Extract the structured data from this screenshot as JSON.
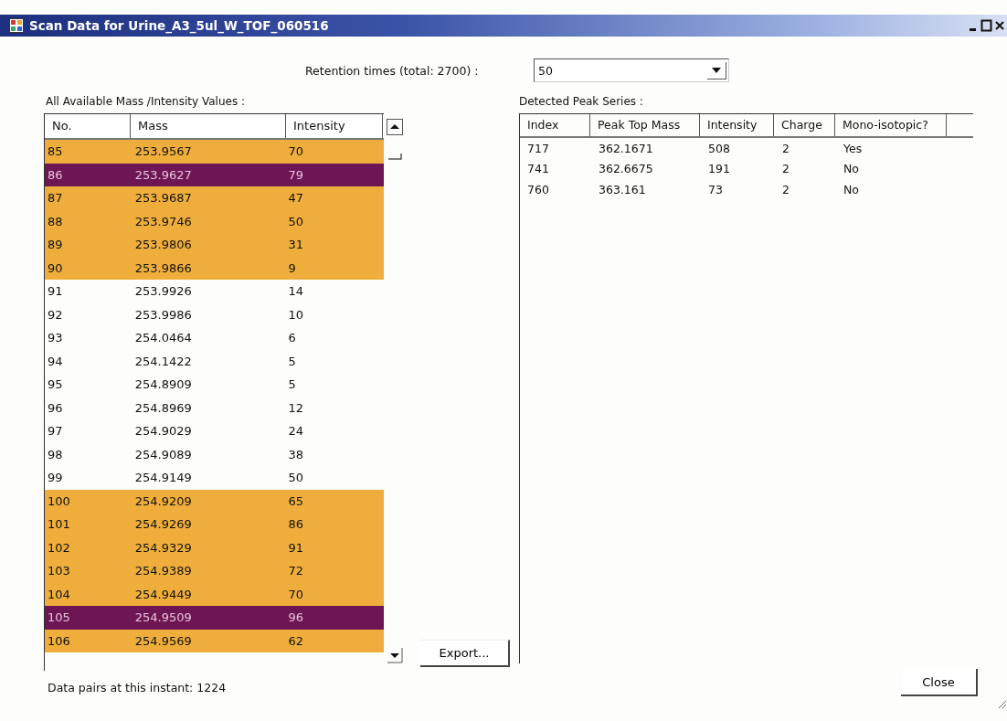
{
  "window": {
    "title": "Scan Data for Urine_A3_5ul_W_TOF_060516"
  },
  "retention": {
    "label": "Retention times (total: 2700) :",
    "value": "50"
  },
  "mass_table": {
    "title": "All Available Mass /Intensity Values :",
    "columns": [
      "No.",
      "Mass",
      "Intensity"
    ],
    "rows": [
      {
        "cells": [
          "85",
          "253.9567",
          "70"
        ],
        "color": "#efae3c"
      },
      {
        "cells": [
          "86",
          "253.9627",
          "79"
        ],
        "color": "#6e1654"
      },
      {
        "cells": [
          "87",
          "253.9687",
          "47"
        ],
        "color": "#efae3c"
      },
      {
        "cells": [
          "88",
          "253.9746",
          "50"
        ],
        "color": "#efae3c"
      },
      {
        "cells": [
          "89",
          "253.9806",
          "31"
        ],
        "color": "#efae3c"
      },
      {
        "cells": [
          "90",
          "253.9866",
          "9"
        ],
        "color": "#efae3c"
      },
      {
        "cells": [
          "91",
          "253.9926",
          "14"
        ]
      },
      {
        "cells": [
          "92",
          "253.9986",
          "10"
        ]
      },
      {
        "cells": [
          "93",
          "254.0464",
          "6"
        ]
      },
      {
        "cells": [
          "94",
          "254.1422",
          "5"
        ]
      },
      {
        "cells": [
          "95",
          "254.8909",
          "5"
        ]
      },
      {
        "cells": [
          "96",
          "254.8969",
          "12"
        ]
      },
      {
        "cells": [
          "97",
          "254.9029",
          "24"
        ]
      },
      {
        "cells": [
          "98",
          "254.9089",
          "38"
        ]
      },
      {
        "cells": [
          "99",
          "254.9149",
          "50"
        ]
      },
      {
        "cells": [
          "100",
          "254.9209",
          "65"
        ],
        "color": "#efae3c"
      },
      {
        "cells": [
          "101",
          "254.9269",
          "86"
        ],
        "color": "#efae3c"
      },
      {
        "cells": [
          "102",
          "254.9329",
          "91"
        ],
        "color": "#efae3c"
      },
      {
        "cells": [
          "103",
          "254.9389",
          "72"
        ],
        "color": "#efae3c"
      },
      {
        "cells": [
          "104",
          "254.9449",
          "70"
        ],
        "color": "#efae3c"
      },
      {
        "cells": [
          "105",
          "254.9509",
          "96"
        ],
        "color": "#6e1654"
      },
      {
        "cells": [
          "106",
          "254.9569",
          "62"
        ],
        "color": "#efae3c"
      }
    ]
  },
  "export_button": "Export...",
  "peak_table": {
    "title": "Detected Peak Series :",
    "columns": [
      "Index",
      "Peak Top Mass",
      "Intensity",
      "Charge",
      "Mono-isotopic?"
    ],
    "rows": [
      [
        "717",
        "362.1671",
        "508",
        "2",
        "Yes"
      ],
      [
        "741",
        "362.6675",
        "191",
        "2",
        "No"
      ],
      [
        "760",
        "363.161",
        "73",
        "2",
        "No"
      ]
    ]
  },
  "status": "Data pairs at this instant: 1224",
  "close_button": "Close"
}
